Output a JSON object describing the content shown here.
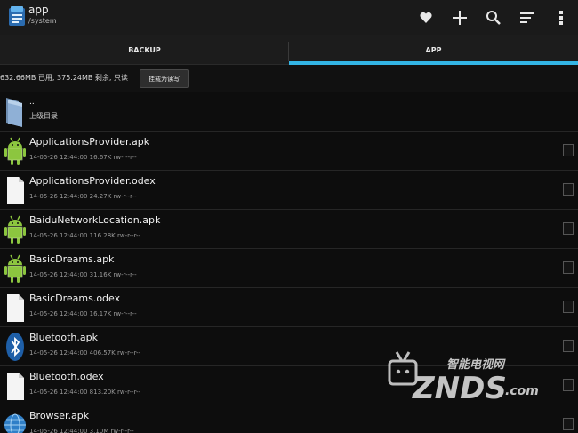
{
  "window": {
    "title": "app",
    "path": "/system"
  },
  "toolbar": {
    "icons": [
      "favorite-icon",
      "add-icon",
      "search-icon",
      "sort-icon",
      "overflow-menu-icon"
    ]
  },
  "tabs": [
    {
      "label": "BACKUP",
      "selected": false
    },
    {
      "label": "APP",
      "selected": true
    }
  ],
  "storage": {
    "text": "632.66MB 已用, 375.24MB 剩余, 只读",
    "mount_button_label": "挂载为读写"
  },
  "parent": {
    "name": "..",
    "label": "上级目录"
  },
  "files": [
    {
      "name": "ApplicationsProvider.apk",
      "meta": "14-05-26 12:44:00  16.67K  rw-r--r--",
      "icon": "android-icon"
    },
    {
      "name": "ApplicationsProvider.odex",
      "meta": "14-05-26 12:44:00  24.27K  rw-r--r--",
      "icon": "file-icon"
    },
    {
      "name": "BaiduNetworkLocation.apk",
      "meta": "14-05-26 12:44:00  116.28K  rw-r--r--",
      "icon": "android-icon"
    },
    {
      "name": "BasicDreams.apk",
      "meta": "14-05-26 12:44:00  31.16K  rw-r--r--",
      "icon": "android-icon"
    },
    {
      "name": "BasicDreams.odex",
      "meta": "14-05-26 12:44:00  16.17K  rw-r--r--",
      "icon": "file-icon"
    },
    {
      "name": "Bluetooth.apk",
      "meta": "14-05-26 12:44:00  406.57K  rw-r--r--",
      "icon": "bluetooth-icon"
    },
    {
      "name": "Bluetooth.odex",
      "meta": "14-05-26 12:44:00  813.20K  rw-r--r--",
      "icon": "file-icon"
    },
    {
      "name": "Browser.apk",
      "meta": "14-05-26 12:44:00  3.10M  rw-r--r--",
      "icon": "globe-icon"
    }
  ],
  "watermark": {
    "chinese": "智能电视网",
    "brand": "ZNDS",
    "suffix": ".com"
  },
  "colors": {
    "accent": "#33b5e5",
    "android_green": "#8cc63f",
    "bluetooth_blue": "#1e5fa8"
  }
}
